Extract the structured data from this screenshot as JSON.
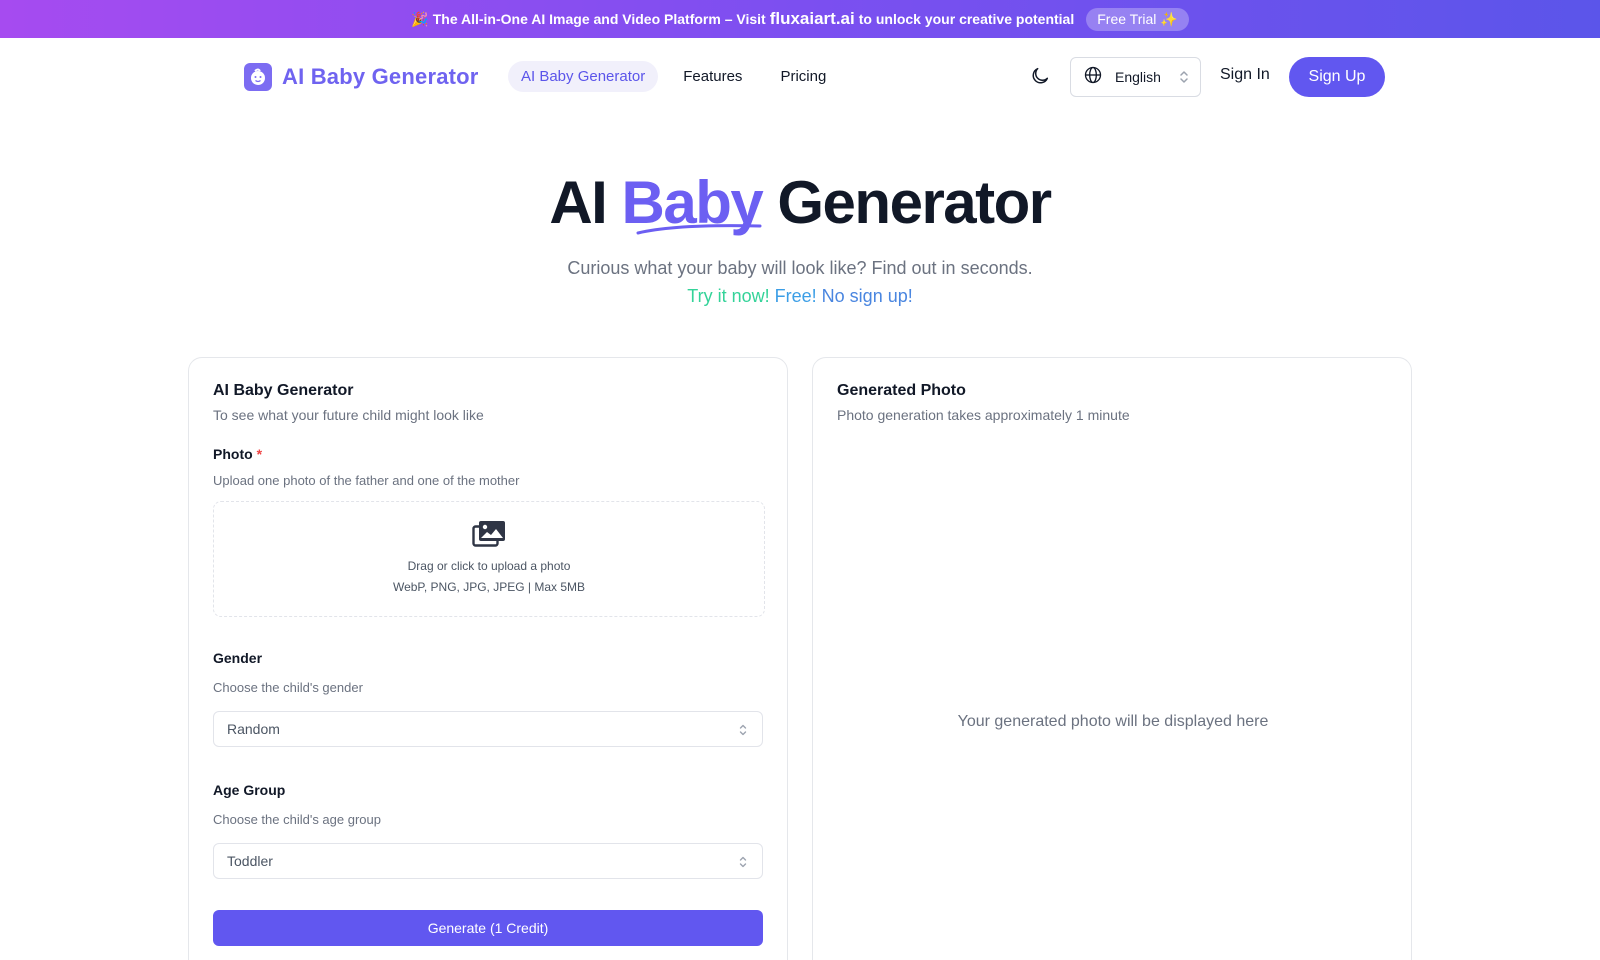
{
  "promo": {
    "emoji": "🎉",
    "text_before": "The All-in-One AI Image and Video Platform – Visit",
    "site": "fluxaiart.ai",
    "text_after": "to unlock your creative potential",
    "trial_label": "Free Trial ✨"
  },
  "header": {
    "logo_text": "AI Baby Generator",
    "nav": [
      {
        "label": "AI Baby Generator",
        "active": true
      },
      {
        "label": "Features",
        "active": false
      },
      {
        "label": "Pricing",
        "active": false
      }
    ],
    "language": "English",
    "sign_in": "Sign In",
    "sign_up": "Sign Up"
  },
  "hero": {
    "title_start": "AI",
    "title_accent": "Baby",
    "title_end": "Generator",
    "subtitle": "Curious what your baby will look like? Find out in seconds.",
    "cta_try": "Try it now!",
    "cta_free": "Free!",
    "cta_nosignup": "No sign up!"
  },
  "form": {
    "title": "AI Baby Generator",
    "description": "To see what your future child might look like",
    "photo_label": "Photo",
    "photo_required": "*",
    "photo_help": "Upload one photo of the father and one of the mother",
    "upload_text": "Drag or click to upload a photo",
    "upload_hint": "WebP, PNG, JPG, JPEG | Max 5MB",
    "gender_label": "Gender",
    "gender_help": "Choose the child's gender",
    "gender_value": "Random",
    "age_label": "Age Group",
    "age_help": "Choose the child's age group",
    "age_value": "Toddler",
    "generate_label": "Generate (1 Credit)"
  },
  "result": {
    "title": "Generated Photo",
    "description": "Photo generation takes approximately 1 minute",
    "placeholder": "Your generated photo will be displayed here"
  },
  "colors": {
    "primary": "#6157f0",
    "accent_text": "#6c5ff2",
    "cta_green": "#34d399",
    "cta_blue": "#3b9ee6",
    "required": "#ef4444"
  },
  "icons": [
    "baby-face-icon",
    "moon-icon",
    "globe-icon",
    "chevron-updown-icon",
    "images-icon"
  ]
}
